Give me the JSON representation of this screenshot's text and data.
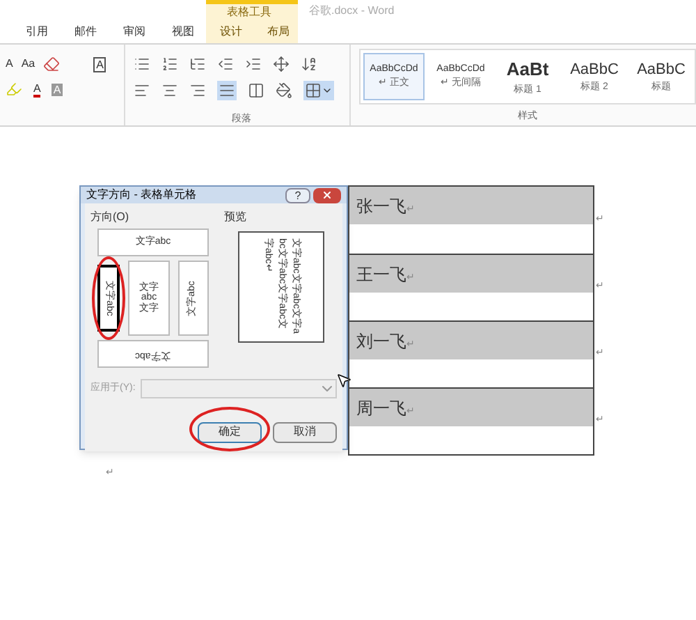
{
  "window": {
    "title": "谷歌.docx - Word"
  },
  "context_tab_group": {
    "label": "表格工具"
  },
  "tabs": [
    {
      "label": "引用",
      "selected": false,
      "contextual": false
    },
    {
      "label": "邮件",
      "selected": false,
      "contextual": false
    },
    {
      "label": "审阅",
      "selected": false,
      "contextual": false
    },
    {
      "label": "视图",
      "selected": false,
      "contextual": false
    },
    {
      "label": "设计",
      "selected": false,
      "contextual": true
    },
    {
      "label": "布局",
      "selected": false,
      "contextual": true
    }
  ],
  "ribbon": {
    "font_group": {
      "grow_font": "A",
      "change_case": "Aa",
      "border_char": "A",
      "font_color": "A",
      "shade_char": "A"
    },
    "paragraph_group": {
      "label": "段落"
    },
    "styles_group": {
      "label": "样式",
      "styles": [
        {
          "sample": "AaBbCcDd",
          "name": "正文",
          "mark": "↵",
          "selected": true,
          "kind": "small"
        },
        {
          "sample": "AaBbCcDd",
          "name": "无间隔",
          "mark": "↵",
          "selected": false,
          "kind": "small"
        },
        {
          "sample": "AaBt",
          "name": "标题 1",
          "selected": false,
          "kind": "bold"
        },
        {
          "sample": "AaBbC",
          "name": "标题 2",
          "selected": false,
          "kind": "large"
        },
        {
          "sample": "AaBbC",
          "name": "标题",
          "selected": false,
          "kind": "large"
        }
      ]
    }
  },
  "dialog": {
    "title": "文字方向 - 表格单元格",
    "help": "?",
    "direction_label": "方向(O)",
    "options": [
      {
        "kind": "horizontal",
        "text": "文字abc",
        "selected": false,
        "annotated": false
      },
      {
        "kind": "rotate90",
        "text": "文字abc",
        "selected": true,
        "annotated": true
      },
      {
        "kind": "stacked",
        "text": "文字abc文字",
        "selected": false,
        "annotated": false
      },
      {
        "kind": "rotate270",
        "text": "文字abc",
        "selected": false,
        "annotated": false
      },
      {
        "kind": "rotate180",
        "text": "文字abc",
        "selected": false,
        "annotated": false
      }
    ],
    "preview_label": "预览",
    "preview_text": "文字abc文字abc文字abc文字abc文字abc文字abc↵",
    "apply_label": "应用于(Y):",
    "apply_disabled": true,
    "buttons": [
      {
        "label": "确定",
        "kind": "default",
        "annotated": true
      },
      {
        "label": "取消",
        "kind": "normal",
        "annotated": false
      }
    ]
  },
  "table": {
    "rows": [
      {
        "text": "张一飞",
        "mark": "↵",
        "end_mark": "↵"
      },
      {
        "text": "王一飞",
        "mark": "↵",
        "end_mark": "↵"
      },
      {
        "text": "刘一飞",
        "mark": "↵",
        "end_mark": "↵"
      },
      {
        "text": "周一飞",
        "mark": "↵",
        "end_mark": "↵"
      }
    ]
  },
  "paragraph_mark": "↵"
}
